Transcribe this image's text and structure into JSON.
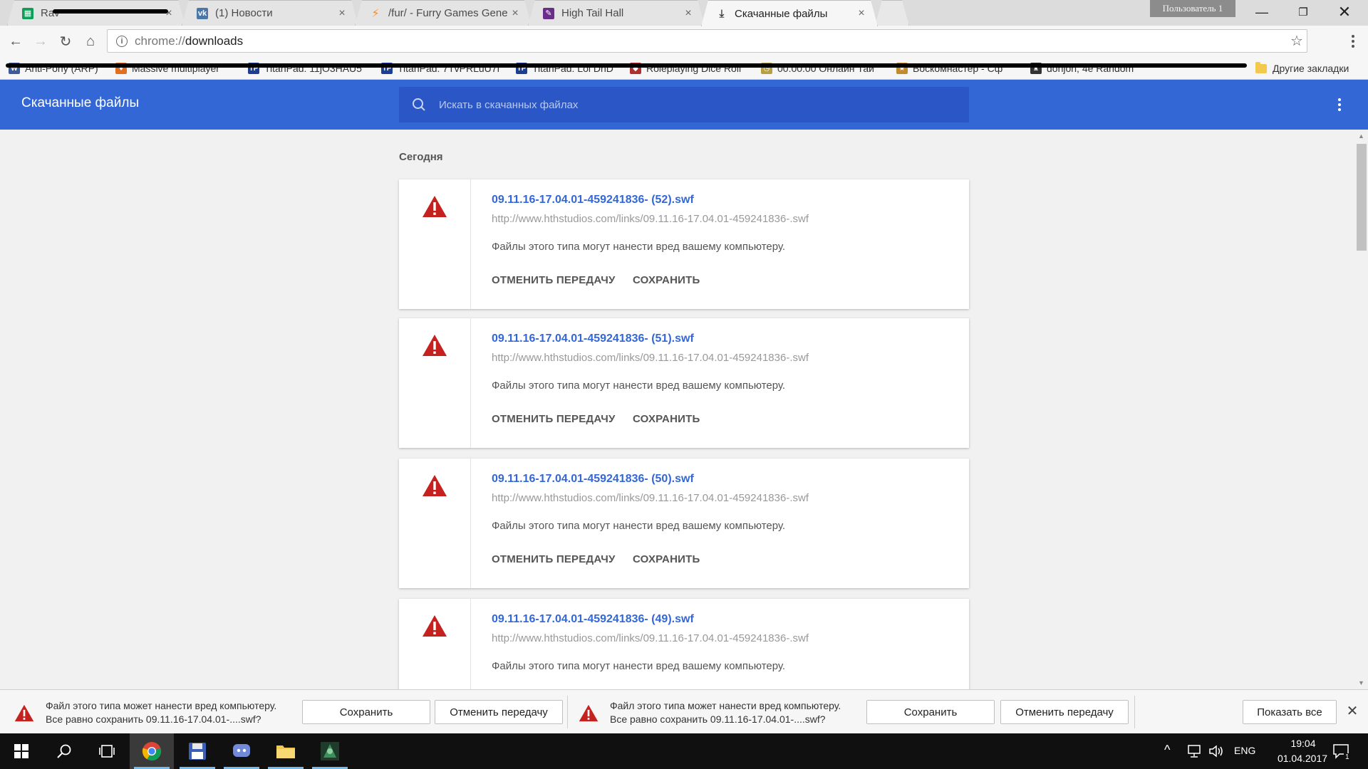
{
  "tabs": [
    {
      "title": "Rav",
      "fav_color": "#0f9d58",
      "active": false
    },
    {
      "title": "(1) Новости",
      "fav_color": "#4a76a8",
      "active": false
    },
    {
      "title": "/fur/ - Furry Games Gene",
      "fav_color": "#ff8c1a",
      "active": false
    },
    {
      "title": "High Tail Hall",
      "fav_color": "#6a2d8a",
      "active": false
    },
    {
      "title": "Скачанные файлы",
      "fav_color": "#555555",
      "active": true
    }
  ],
  "window": {
    "user_label": "Пользователь 1"
  },
  "address": {
    "scheme": "chrome://",
    "path": "downloads"
  },
  "bookmarks": {
    "items": [
      "Anti-Pony (ARP)",
      "Massive multiplayer",
      "TitanPad: 11jO3HAU5",
      "TitanPad: 7TvPRLuU7f",
      "TitanPad: Lol DnD",
      "Roleplaying Dice Roll",
      "00:00:00 Онлайн Тай",
      "Воскомнастер - Сф",
      "donjon; 4e Random"
    ],
    "other": "Другие закладки"
  },
  "downloads": {
    "title": "Скачанные файлы",
    "search_placeholder": "Искать в скачанных файлах",
    "section": "Сегодня",
    "cancel_label": "ОТМЕНИТЬ ПЕРЕДАЧУ",
    "save_label": "СОХРАНИТЬ",
    "items": [
      {
        "name": "09.11.16-17.04.01-459241836- (52).swf",
        "url": "http://www.hthstudios.com/links/09.11.16-17.04.01-459241836-.swf",
        "desc": "Файлы этого типа могут нанести вред вашему компьютеру."
      },
      {
        "name": "09.11.16-17.04.01-459241836- (51).swf",
        "url": "http://www.hthstudios.com/links/09.11.16-17.04.01-459241836-.swf",
        "desc": "Файлы этого типа могут нанести вред вашему компьютеру."
      },
      {
        "name": "09.11.16-17.04.01-459241836- (50).swf",
        "url": "http://www.hthstudios.com/links/09.11.16-17.04.01-459241836-.swf",
        "desc": "Файлы этого типа могут нанести вред вашему компьютеру."
      },
      {
        "name": "09.11.16-17.04.01-459241836- (49).swf",
        "url": "http://www.hthstudios.com/links/09.11.16-17.04.01-459241836-.swf",
        "desc": "Файлы этого типа могут нанести вред вашему компьютеру."
      }
    ]
  },
  "shelf": {
    "items": [
      {
        "line1": "Файл этого типа может нанести вред компьютеру.",
        "line2": "Все равно сохранить 09.11.16-17.04.01-....swf?",
        "save": "Сохранить",
        "cancel": "Отменить передачу"
      },
      {
        "line1": "Файл этого типа может нанести вред компьютеру.",
        "line2": "Все равно сохранить 09.11.16-17.04.01-....swf?",
        "save": "Сохранить",
        "cancel": "Отменить передачу"
      }
    ],
    "show_all": "Показать все"
  },
  "taskbar": {
    "lang": "ENG",
    "time": "19:04",
    "date": "01.04.2017",
    "notification_count": "1"
  },
  "colors": {
    "header": "#3367d6",
    "link": "#3367d6",
    "warning": "#c5221f"
  }
}
